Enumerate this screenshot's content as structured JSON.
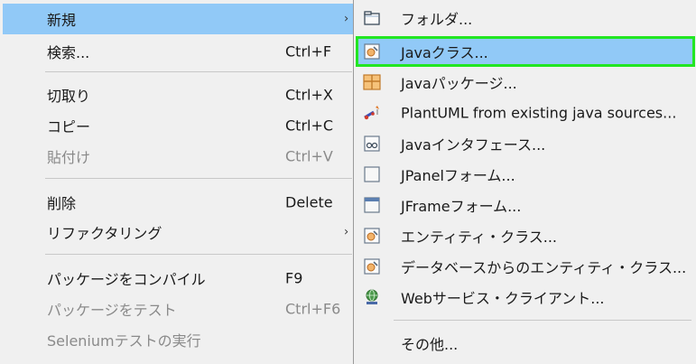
{
  "context_menu": {
    "items": [
      {
        "label": "新規",
        "shortcut": "",
        "has_submenu": true,
        "state": "highlighted"
      },
      {
        "label": "検索...",
        "shortcut": "Ctrl+F",
        "state": "enabled"
      },
      {
        "label": "切取り",
        "shortcut": "Ctrl+X",
        "state": "enabled"
      },
      {
        "label": "コピー",
        "shortcut": "Ctrl+C",
        "state": "enabled"
      },
      {
        "label": "貼付け",
        "shortcut": "Ctrl+V",
        "state": "disabled"
      },
      {
        "label": "削除",
        "shortcut": "Delete",
        "state": "enabled"
      },
      {
        "label": "リファクタリング",
        "shortcut": "",
        "has_submenu": true,
        "state": "enabled"
      },
      {
        "label": "パッケージをコンパイル",
        "shortcut": "F9",
        "state": "enabled"
      },
      {
        "label": "パッケージをテスト",
        "shortcut": "Ctrl+F6",
        "state": "disabled"
      },
      {
        "label": "Seleniumテストの実行",
        "shortcut": "",
        "state": "disabled"
      }
    ]
  },
  "submenu": {
    "items": [
      {
        "label": "フォルダ...",
        "icon": "folder-icon"
      },
      {
        "label": "Javaクラス...",
        "icon": "java-class-icon",
        "state": "highlighted"
      },
      {
        "label": "Javaパッケージ...",
        "icon": "java-package-icon"
      },
      {
        "label": "PlantUML from existing java sources...",
        "icon": "plantuml-icon"
      },
      {
        "label": "Javaインタフェース...",
        "icon": "java-interface-icon"
      },
      {
        "label": "JPanelフォーム...",
        "icon": "jpanel-form-icon"
      },
      {
        "label": "JFrameフォーム...",
        "icon": "jframe-form-icon"
      },
      {
        "label": "エンティティ・クラス...",
        "icon": "entity-class-icon"
      },
      {
        "label": "データベースからのエンティティ・クラス...",
        "icon": "db-entity-class-icon"
      },
      {
        "label": "Webサービス・クライアント...",
        "icon": "web-service-client-icon"
      },
      {
        "label": "その他...",
        "icon": ""
      }
    ]
  },
  "colors": {
    "menu_bg": "#f0f0f0",
    "highlight": "#91c9f7",
    "focus_outline": "#22e622",
    "disabled_text": "#8a8a8a"
  }
}
